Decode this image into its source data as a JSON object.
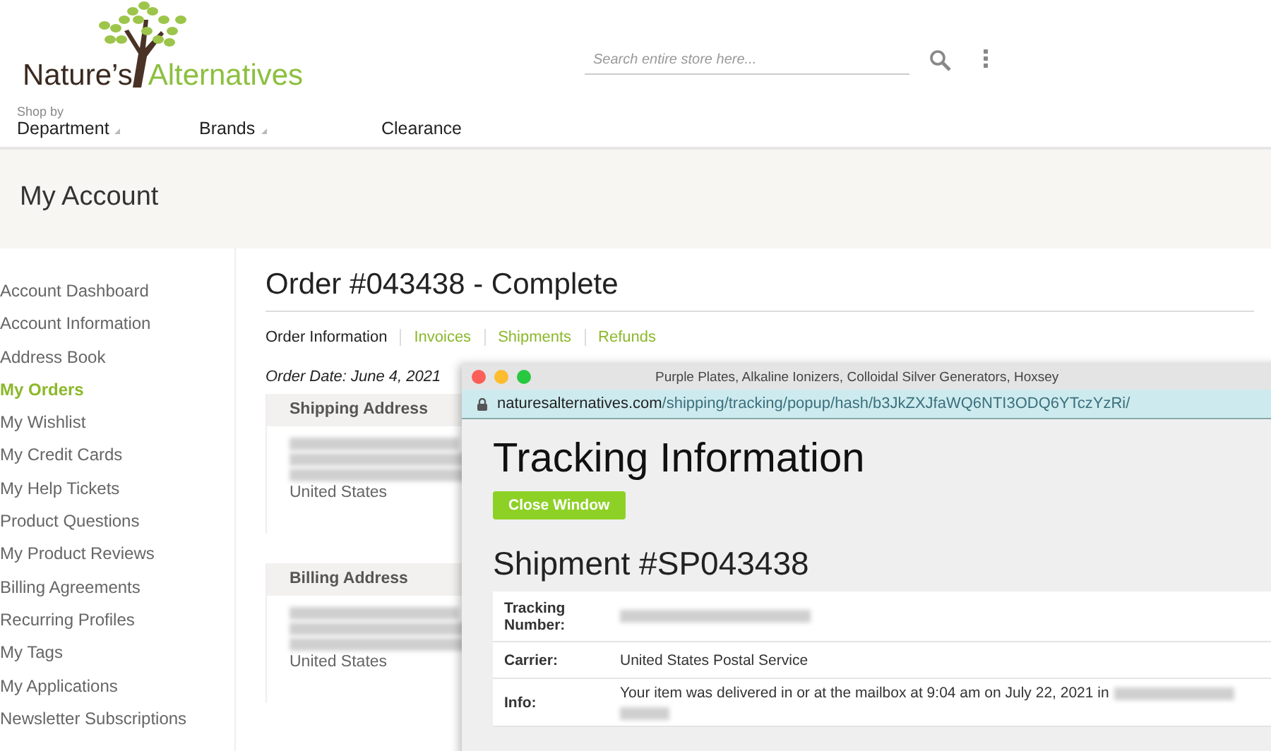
{
  "logo": {
    "part_1": "Nature’s",
    "part_2": "Alternatives"
  },
  "search": {
    "placeholder": "Search entire store here..."
  },
  "nav": [
    {
      "small": "Shop by",
      "label": "Department",
      "dropdown": true
    },
    {
      "label": "Brands",
      "dropdown": true
    },
    {
      "label": "Clearance",
      "dropdown": false
    }
  ],
  "page_title": "My Account",
  "sidebar": {
    "items": [
      {
        "label": "Account Dashboard",
        "selected": false
      },
      {
        "label": "Account Information",
        "selected": false
      },
      {
        "label": "Address Book",
        "selected": false
      },
      {
        "label": "My Orders",
        "selected": true
      },
      {
        "label": "My Wishlist",
        "selected": false
      },
      {
        "label": "My Credit Cards",
        "selected": false
      },
      {
        "label": "My Help Tickets",
        "selected": false
      },
      {
        "label": "Product Questions",
        "selected": false
      },
      {
        "label": "My Product Reviews",
        "selected": false
      },
      {
        "label": "Billing Agreements",
        "selected": false
      },
      {
        "label": "Recurring Profiles",
        "selected": false
      },
      {
        "label": "My Tags",
        "selected": false
      },
      {
        "label": "My Applications",
        "selected": false
      },
      {
        "label": "Newsletter Subscriptions",
        "selected": false
      }
    ]
  },
  "order": {
    "title": "Order #043438 - Complete",
    "tabs": [
      {
        "label": "Order Information",
        "selected": true
      },
      {
        "label": "Invoices",
        "selected": false
      },
      {
        "label": "Shipments",
        "selected": false
      },
      {
        "label": "Refunds",
        "selected": false
      }
    ],
    "date": "Order Date: June 4, 2021",
    "addresses": [
      {
        "title": "Shipping Address",
        "lines": [
          {
            "kind": "blurred"
          },
          {
            "kind": "blurred"
          },
          {
            "kind": "blurred"
          },
          {
            "kind": "text",
            "text": "United States"
          }
        ]
      },
      {
        "title": "Billing Address",
        "lines": [
          {
            "kind": "blurred"
          },
          {
            "kind": "blurred"
          },
          {
            "kind": "blurred"
          },
          {
            "kind": "text",
            "text": "United States"
          }
        ]
      }
    ]
  },
  "popup": {
    "window_title": "Purple Plates, Alkaline Ionizers, Colloidal Silver Generators, Hoxsey",
    "url_domain": "naturesalternatives.com",
    "url_path": "/shipping/tracking/popup/hash/b3JkZXJfaWQ6NTI3ODQ6YTczYzRi/",
    "heading": "Tracking Information",
    "close_button": "Close Window",
    "shipment": "Shipment #SP043438",
    "rows": [
      {
        "label": "Tracking Number:",
        "kind": "blurred"
      },
      {
        "label": "Carrier:",
        "kind": "text",
        "value": "United States Postal Service"
      },
      {
        "label": "Info:",
        "kind": "text_blurred",
        "value": "Your item was delivered in or at the mailbox at 9:04 am on July 22, 2021 in"
      }
    ]
  }
}
